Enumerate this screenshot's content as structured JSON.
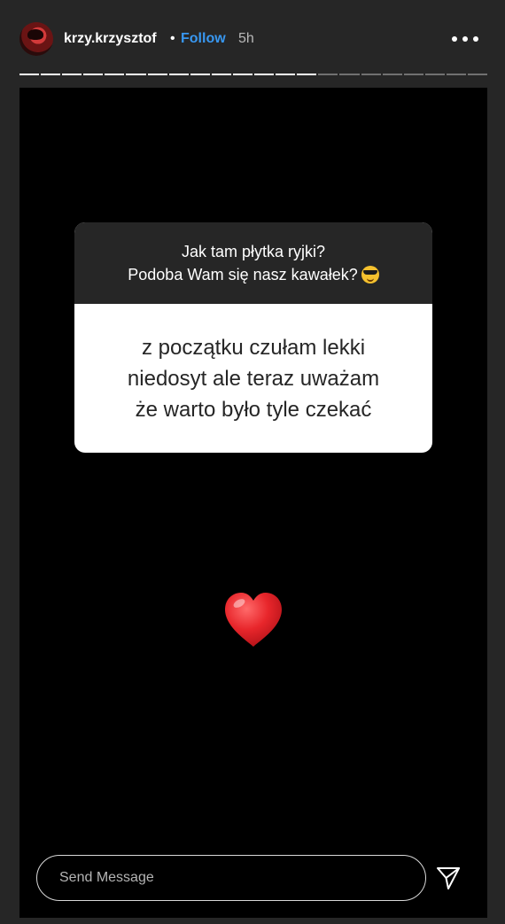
{
  "header": {
    "username": "krzy.krzysztof",
    "separator": "•",
    "follow_label": "Follow",
    "time_ago": "5h"
  },
  "progress": {
    "segments_total": 22,
    "segments_viewed": 14
  },
  "question_card": {
    "question_lines": [
      "Jak tam płytka ryjki?",
      "Podoba Wam się nasz kawałek?"
    ],
    "question_emoji": "smiling-face-with-sunglasses",
    "answer_lines": [
      "z początku czułam lekki",
      "niedosyt ale teraz uważam",
      "że warto było tyle czekać"
    ]
  },
  "sticker": {
    "emoji": "red-heart"
  },
  "reply": {
    "placeholder": "Send Message"
  },
  "colors": {
    "background": "#262626",
    "story_bg": "#000000",
    "follow": "#3897f0",
    "heart": "#e8262b",
    "card_top": "#262626",
    "card_bottom": "#ffffff"
  },
  "icons": {
    "more": "more-horizontal-icon",
    "send": "paper-plane-icon"
  }
}
